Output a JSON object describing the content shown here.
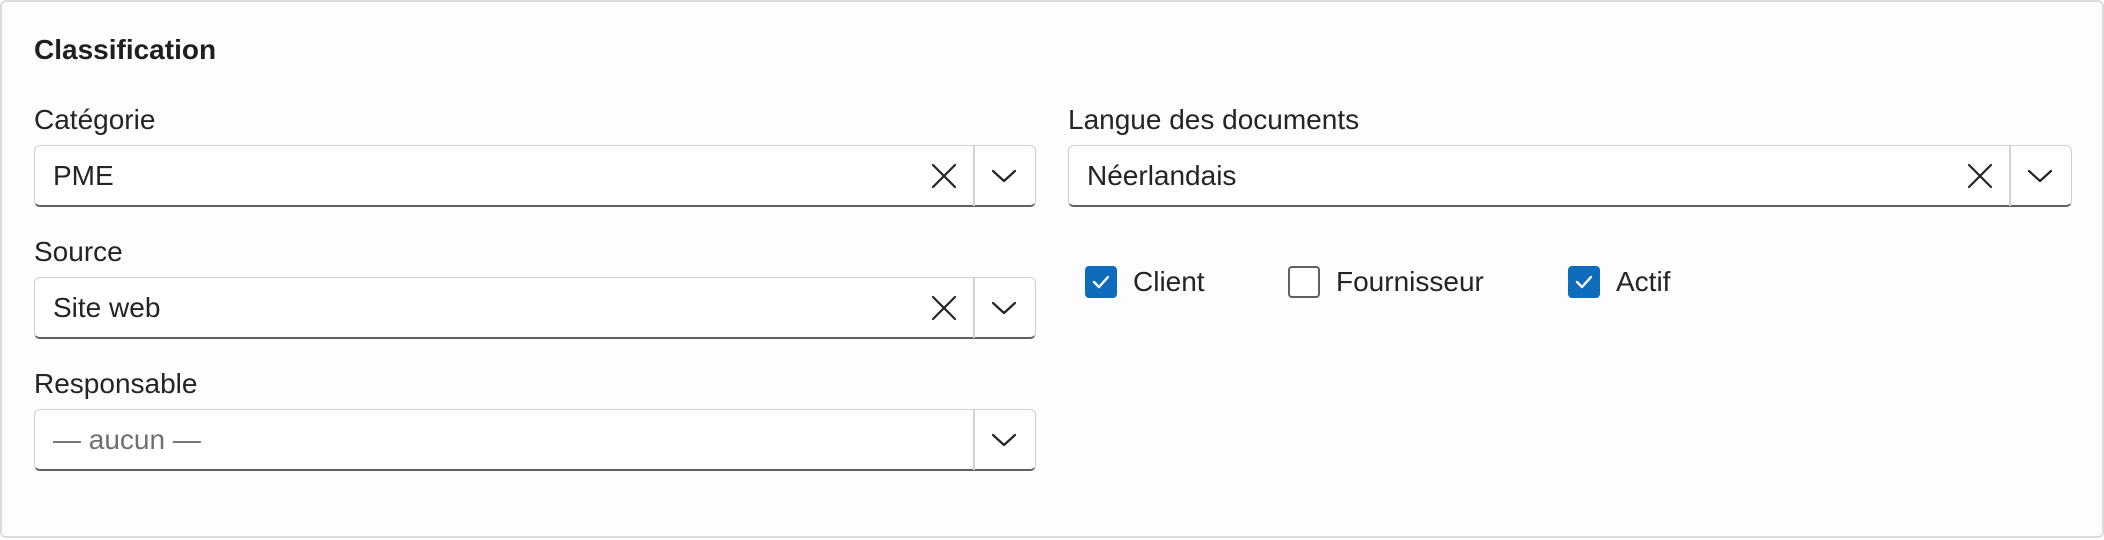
{
  "section": {
    "title": "Classification"
  },
  "fields": {
    "categorie": {
      "label": "Catégorie",
      "value": "PME"
    },
    "source": {
      "label": "Source",
      "value": "Site web"
    },
    "responsable": {
      "label": "Responsable",
      "placeholder": "— aucun —"
    },
    "langue": {
      "label": "Langue des documents",
      "value": "Néerlandais"
    }
  },
  "checkboxes": [
    {
      "label": "Client",
      "checked": true
    },
    {
      "label": "Fournisseur",
      "checked": false
    },
    {
      "label": "Actif",
      "checked": true
    }
  ],
  "colors": {
    "accent": "#0f6cbd",
    "border": "#d1d1d1",
    "text": "#242424"
  },
  "icons": {
    "clear": "close-icon",
    "open": "chevron-down-icon",
    "check": "checkmark-icon"
  }
}
